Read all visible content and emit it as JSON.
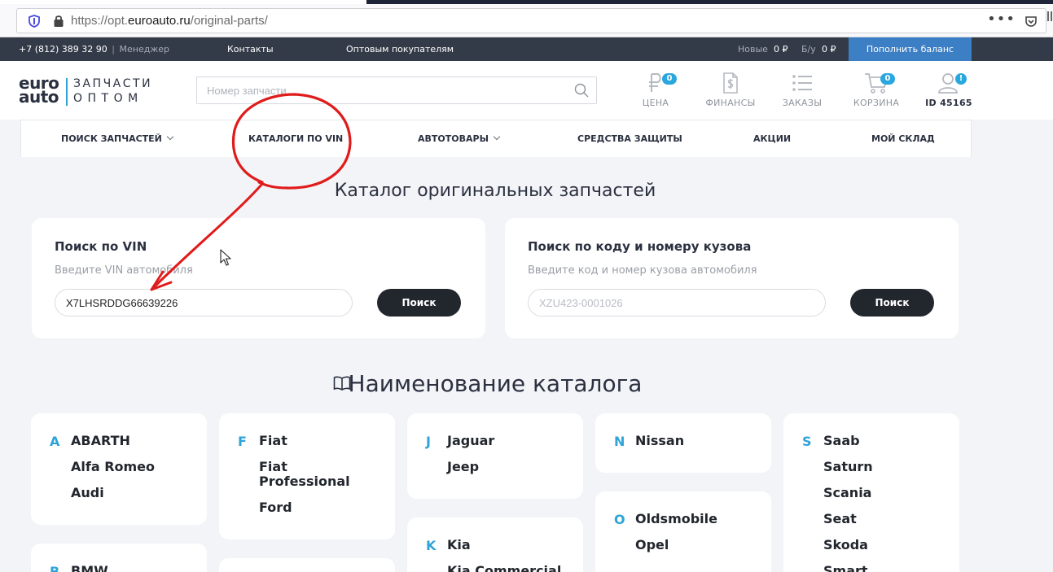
{
  "browser": {
    "url_prefix": "https://opt.",
    "url_domain": "euroauto.ru",
    "url_path": "/original-parts/",
    "menu_dots": "•••"
  },
  "topbar": {
    "phone": "+7 (812) 389 32 90",
    "divider": "|",
    "manager": "Менеджер",
    "contacts": "Контакты",
    "wholesale": "Оптовым покупателям",
    "new_label": "Новые",
    "new_value": "0 ₽",
    "used_label": "Б/у",
    "used_value": "0 ₽",
    "topup": "Пополнить баланс"
  },
  "logo": {
    "line1": "euro",
    "line2": "auto",
    "sub1": "ЗАПЧАСТИ",
    "sub2": "ОПТОМ"
  },
  "search": {
    "placeholder": "Номер запчасти"
  },
  "header_icons": {
    "price": {
      "label": "ЦЕНА",
      "badge": "0"
    },
    "finance": {
      "label": "ФИНАНСЫ"
    },
    "orders": {
      "label": "ЗАКАЗЫ"
    },
    "cart": {
      "label": "КОРЗИНА",
      "badge": "0"
    },
    "profile": {
      "label": "ID 45165",
      "badge": "!"
    }
  },
  "nav": {
    "items": [
      {
        "label": "ПОИСК ЗАПЧАСТЕЙ"
      },
      {
        "label": "КАТАЛОГИ ПО VIN"
      },
      {
        "label": "АВТОТОВАРЫ"
      },
      {
        "label": "СРЕДСТВА ЗАЩИТЫ"
      },
      {
        "label": "АКЦИИ"
      },
      {
        "label": "МОЙ СКЛАД"
      }
    ]
  },
  "page_title": "Каталог оригинальных запчастей",
  "vin_search": {
    "title": "Поиск по VIN",
    "hint": "Введите VIN автомобиля",
    "value": "X7LHSRDDG66639226",
    "button": "Поиск"
  },
  "frame_search": {
    "title": "Поиск по коду и номеру кузова",
    "hint": "Введите код и номер кузова автомобиля",
    "placeholder": "XZU423-0001026",
    "button": "Поиск"
  },
  "catalog_title": "Наименование каталога",
  "brands": {
    "a": {
      "letter": "A",
      "items": [
        "ABARTH",
        "Alfa Romeo",
        "Audi"
      ]
    },
    "b": {
      "letter": "B",
      "items": [
        "BMW"
      ]
    },
    "f": {
      "letter": "F",
      "items": [
        "Fiat",
        "Fiat Professional",
        "Ford"
      ]
    },
    "j": {
      "letter": "J",
      "items": [
        "Jaguar",
        "Jeep"
      ]
    },
    "k": {
      "letter": "K",
      "items": [
        "Kia",
        "Kia Commercial"
      ]
    },
    "n": {
      "letter": "N",
      "items": [
        "Nissan"
      ]
    },
    "o": {
      "letter": "O",
      "items": [
        "Oldsmobile",
        "Opel"
      ]
    },
    "s": {
      "letter": "S",
      "items": [
        "Saab",
        "Saturn",
        "Scania",
        "Seat",
        "Skoda",
        "Smart"
      ]
    }
  },
  "colors": {
    "accent": "#2fa3d8",
    "topbar": "#343b48",
    "button_dark": "#22262d",
    "topup_button": "#3d7fc4",
    "annotation": "#e01b1b"
  }
}
